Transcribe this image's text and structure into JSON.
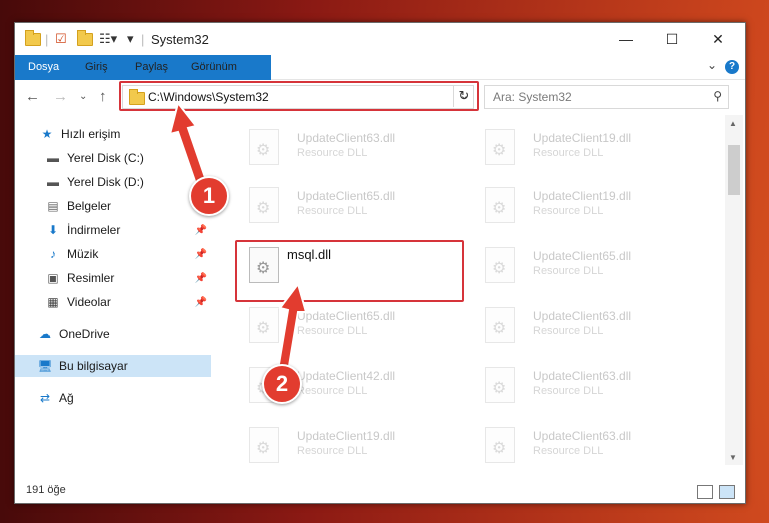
{
  "window": {
    "title": "System32"
  },
  "ribbon": {
    "tabs": [
      "Dosya",
      "Giriş",
      "Paylaş",
      "Görünüm"
    ]
  },
  "nav": {
    "address": "C:\\Windows\\System32",
    "search_placeholder": "Ara: System32"
  },
  "sidebar": {
    "items": [
      {
        "label": "Hızlı erişim",
        "icon": "star-icon"
      },
      {
        "label": "Yerel Disk (C:)",
        "icon": "drive-icon"
      },
      {
        "label": "Yerel Disk (D:)",
        "icon": "drive-icon"
      },
      {
        "label": "Belgeler",
        "icon": "document-icon"
      },
      {
        "label": "İndirmeler",
        "icon": "download-icon"
      },
      {
        "label": "Müzik",
        "icon": "music-icon"
      },
      {
        "label": "Resimler",
        "icon": "image-icon"
      },
      {
        "label": "Videolar",
        "icon": "video-icon"
      },
      {
        "label": "OneDrive",
        "icon": "cloud-icon"
      },
      {
        "label": "Bu bilgisayar",
        "icon": "computer-icon"
      },
      {
        "label": "Ağ",
        "icon": "network-icon"
      }
    ]
  },
  "files": [
    {
      "name": "UpdateClient63.dll",
      "type": "Resource DLL"
    },
    {
      "name": "UpdateClient19.dll",
      "type": "Resource DLL"
    },
    {
      "name": "UpdateClient65.dll",
      "type": "Resource DLL"
    },
    {
      "name": "UpdateClient19.dll",
      "type": "Resource DLL"
    },
    {
      "name": "msql.dll",
      "type": ""
    },
    {
      "name": "UpdateClient65.dll",
      "type": "Resource DLL"
    },
    {
      "name": "UpdateClient65.dll",
      "type": "Resource DLL"
    },
    {
      "name": "UpdateClient63.dll",
      "type": "Resource DLL"
    },
    {
      "name": "UpdateClient42.dll",
      "type": "Resource DLL"
    },
    {
      "name": "UpdateClient63.dll",
      "type": "Resource DLL"
    },
    {
      "name": "UpdateClient19.dll",
      "type": "Resource DLL"
    },
    {
      "name": "UpdateClient63.dll",
      "type": "Resource DLL"
    }
  ],
  "status": {
    "count": "191 öğe"
  },
  "annotations": {
    "badge1": "1",
    "badge2": "2"
  },
  "colors": {
    "accent": "#1979ca",
    "highlight": "#d6343a",
    "selected": "#cce4f7"
  }
}
